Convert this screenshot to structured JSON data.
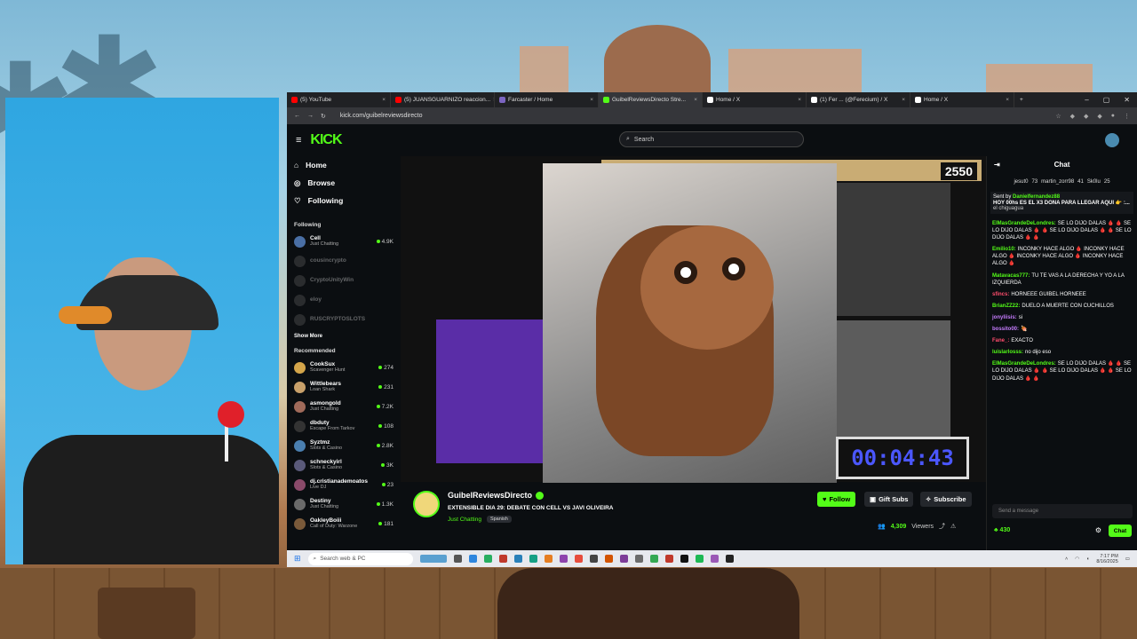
{
  "browser": {
    "tabs": [
      {
        "label": "(5) YouTube",
        "color": "#ff0000",
        "active": false
      },
      {
        "label": "(5) JUANSGUARNIZO reaccion...",
        "color": "#ff0000",
        "active": false
      },
      {
        "label": "Farcaster / Home",
        "color": "#7c65c1",
        "active": false
      },
      {
        "label": "GuibelReviewsDirecto Stre...",
        "color": "#53fc18",
        "active": true
      },
      {
        "label": "Home / X",
        "color": "#ffffff",
        "active": false
      },
      {
        "label": "(1) Fer ... (@Ferecium) / X",
        "color": "#ffffff",
        "active": false
      },
      {
        "label": "Home / X",
        "color": "#ffffff",
        "active": false
      }
    ],
    "url": "kick.com/guibelreviewsdirecto"
  },
  "kick": {
    "logo": "KICK",
    "search_placeholder": "Search",
    "nav": {
      "home": "Home",
      "browse": "Browse",
      "following": "Following"
    },
    "following_header": "Following",
    "following": [
      {
        "name": "Cell",
        "category": "Just Chatting",
        "count": "4.9K",
        "live": true
      },
      {
        "name": "cousincrypto",
        "category": "",
        "count": "",
        "live": false
      },
      {
        "name": "CryptoUnityWin",
        "category": "",
        "count": "",
        "live": false
      },
      {
        "name": "eloy",
        "category": "",
        "count": "",
        "live": false
      },
      {
        "name": "RUSCRYPTOSLOTS",
        "category": "",
        "count": "",
        "live": false
      }
    ],
    "show_more": "Show More",
    "recommended_header": "Recommended",
    "recommended": [
      {
        "name": "CookSux",
        "category": "Scavenger Hunt",
        "count": "274"
      },
      {
        "name": "Wittlebears",
        "category": "Loan Shark",
        "count": "231"
      },
      {
        "name": "asmongold",
        "category": "Just Chatting",
        "count": "7.2K"
      },
      {
        "name": "dbduty",
        "category": "Escape From Tarkov",
        "count": "108"
      },
      {
        "name": "Syztmz",
        "category": "Slots & Casino",
        "count": "2.8K"
      },
      {
        "name": "schneckyirl",
        "category": "Slots & Casino",
        "count": "3K"
      },
      {
        "name": "dj.cristianademoatos",
        "category": "Live DJ",
        "count": "23"
      },
      {
        "name": "Destiny",
        "category": "Just Chatting",
        "count": "1.3K"
      },
      {
        "name": "OakleyBoiii",
        "category": "Call of Duty: Warzone",
        "count": "181"
      }
    ],
    "video": {
      "goal_count": "2550",
      "timer": "00:04:43"
    },
    "channel": {
      "name": "GuibelReviewsDirecto",
      "title": "EXTENSIBLE DIA 29: DEBATE CON CELL VS JAVI OLIVEIRA",
      "category": "Just Chatting",
      "language": "Spanish",
      "viewers": "4,309",
      "viewers_label": "Viewers"
    },
    "buttons": {
      "follow": "Follow",
      "gift": "Gift Subs",
      "subscribe": "Subscribe"
    },
    "chat": {
      "header": "Chat",
      "top_gifters": [
        {
          "name": "jesut0",
          "value": "73"
        },
        {
          "name": "martin_zorr98",
          "value": "41"
        },
        {
          "name": "Sk0lu",
          "value": "25"
        }
      ],
      "pinned_by": "Sent by",
      "pinned_user": "Danielfernandez88",
      "pinned_text": "HOY 00hs ES EL X3 DONA PARA LLEGAR AQUI 👉 :...",
      "reply_preview": "el chiguagua",
      "messages": [
        {
          "user": "ElMasGrandeDeLondres:",
          "text": "SE LO DIJO DALAS 🩸 🩸 SE LO DIJO DALAS 🩸 🩸 SE LO DIJO DALAS 🩸 🩸 SE LO DIJO DALAS 🩸 🩸",
          "color": "#53fc18"
        },
        {
          "user": "Emilio10:",
          "text": "INCONKY HACE ALGO 🩸 INCONKY HACE ALGO 🩸 INCONKY HACE ALGO 🩸 INCONKY HACE ALGO 🩸",
          "color": "#53fc18"
        },
        {
          "user": "Matavacas777:",
          "text": "TU TE VAS A LA DERECHA Y YO A LA IZQUIERDA",
          "color": "#53fc18"
        },
        {
          "user": "sfincs:",
          "text": "HORNEEE GUIBEL HORNEEE",
          "color": "#ff4d6d"
        },
        {
          "user": "BrianZZ22:",
          "text": "DUELO A MUERTE CON CUCHILLOS",
          "color": "#53fc18"
        },
        {
          "user": "jonyliisis:",
          "text": "si",
          "color": "#c77dff"
        },
        {
          "user": "bossito00:",
          "text": "🍖",
          "color": "#c77dff"
        },
        {
          "user": "Fane_:",
          "text": "EXACTO",
          "color": "#ff4d6d"
        },
        {
          "user": "luislarlosss:",
          "text": "no dijo eso",
          "color": "#53fc18"
        },
        {
          "user": "ElMasGrandeDeLondres:",
          "text": "SE LO DIJO DALAS 🩸 🩸 SE LO DIJO DALAS 🩸 🩸 SE LO DIJO DALAS 🩸 🩸 SE LO DIJO DALAS 🩸 🩸",
          "color": "#53fc18"
        }
      ],
      "input_placeholder": "Send a message",
      "points": "430",
      "send": "Chat"
    }
  },
  "taskbar": {
    "search_placeholder": "Search web & PC",
    "time": "7:17 PM",
    "date": "8/16/2025"
  },
  "colors": {
    "kick_green": "#53fc18",
    "kick_bg": "#0b0e11"
  }
}
